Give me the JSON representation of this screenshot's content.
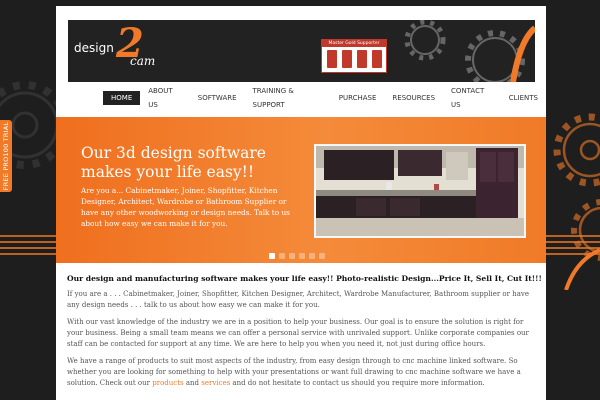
{
  "trial_tab": {
    "label": "FREE PRO100 TRIAL"
  },
  "header": {
    "logo": {
      "part1": "design",
      "part2": "2",
      "part3": "cam"
    },
    "partner_badge": "Master Gold Supporter"
  },
  "nav": {
    "items": [
      {
        "label": "HOME",
        "active": true
      },
      {
        "label": "ABOUT US"
      },
      {
        "label": "SOFTWARE"
      },
      {
        "label": "TRAINING & SUPPORT"
      },
      {
        "label": "PURCHASE"
      },
      {
        "label": "RESOURCES"
      },
      {
        "label": "CONTACT US"
      },
      {
        "label": "CLIENTS"
      }
    ]
  },
  "banner": {
    "heading": "Our 3d design software makes your life easy!!",
    "text": "Are you a... Cabinetmaker, Joiner, Shopfitter, Kitchen Designer, Architect, Wardrobe or Bathroom Supplier or have any other woodworking or design needs. Talk to us about how easy we can make it for you.",
    "slides_count": 6,
    "active_slide": 1
  },
  "content": {
    "headline": "Our design and manufacturing software makes your life easy!!   Photo-realistic Design...Price It, Sell It, Cut It!!!",
    "p1": "If you are a . . . Cabinetmaker, Joiner, Shopfitter, Kitchen Designer, Architect, Wardrobe Manufacturer, Bathroom supplier or have any design needs . . . talk to us about how easy we can make it for you.",
    "p2": "With our vast knowledge of the industry we are in a position to help your business. Our goal is to ensure the solution is right for your business. Being a small team means we can offer a personal service with unrivaled support. Unlike corporate companies our staff can be contacted for support at any time. We are here to help you when you need it, not just during office hours.",
    "p3_before": "We have a range of products to suit most aspects of the industry, from easy design through to cnc machine linked software. So whether you are looking for something to help with your presentations or want full drawing to cnc machine software we have a solution. Check out our",
    "link_products": "products",
    "and": "and",
    "link_services": "services",
    "p3_after": "and do not hesitate to contact us should you require more information."
  },
  "colors": {
    "accent": "#f07a27",
    "dark": "#222222",
    "background": "#1e1e1e"
  }
}
